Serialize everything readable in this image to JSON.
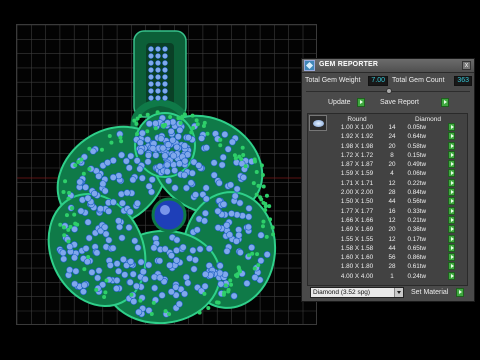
{
  "panel": {
    "title": "GEM REPORTER",
    "close_label": "x",
    "total_weight_label": "Total Gem Weight",
    "total_weight_value": "7.00",
    "total_count_label": "Total Gem Count",
    "total_count_value": "363",
    "update_label": "Update",
    "save_report_label": "Save Report",
    "header_shape": "Round",
    "header_material": "Diamond",
    "rows": [
      {
        "size": "1.00 X 1.00",
        "count": "14",
        "weight": "0.05tw"
      },
      {
        "size": "1.92 X 1.92",
        "count": "24",
        "weight": "0.64tw"
      },
      {
        "size": "1.98 X 1.98",
        "count": "20",
        "weight": "0.58tw"
      },
      {
        "size": "1.72 X 1.72",
        "count": "8",
        "weight": "0.15tw"
      },
      {
        "size": "1.87 X 1.87",
        "count": "20",
        "weight": "0.49tw"
      },
      {
        "size": "1.59 X 1.59",
        "count": "4",
        "weight": "0.06tw"
      },
      {
        "size": "1.71 X 1.71",
        "count": "12",
        "weight": "0.22tw"
      },
      {
        "size": "2.00 X 2.00",
        "count": "28",
        "weight": "0.84tw"
      },
      {
        "size": "1.50 X 1.50",
        "count": "44",
        "weight": "0.56tw"
      },
      {
        "size": "1.77 X 1.77",
        "count": "16",
        "weight": "0.33tw"
      },
      {
        "size": "1.66 X 1.66",
        "count": "12",
        "weight": "0.21tw"
      },
      {
        "size": "1.69 X 1.69",
        "count": "20",
        "weight": "0.36tw"
      },
      {
        "size": "1.55 X 1.55",
        "count": "12",
        "weight": "0.17tw"
      },
      {
        "size": "1.58 X 1.58",
        "count": "44",
        "weight": "0.65tw"
      },
      {
        "size": "1.60 X 1.60",
        "count": "56",
        "weight": "0.86tw"
      },
      {
        "size": "1.80 X 1.80",
        "count": "28",
        "weight": "0.61tw"
      },
      {
        "size": "4.00 X 4.00",
        "count": "1",
        "weight": "0.24tw"
      }
    ],
    "material_select": "Diamond    (3.52 spg)",
    "set_material_label": "Set Material"
  },
  "colors": {
    "metal": "#0f7a48",
    "gem": "#7fa8ec",
    "accent_button": "#3fa83f",
    "value_text": "#36c8d8"
  },
  "icons": [
    "app-icon",
    "gem-thumbnail-icon",
    "close-icon",
    "green-arrow-button"
  ]
}
